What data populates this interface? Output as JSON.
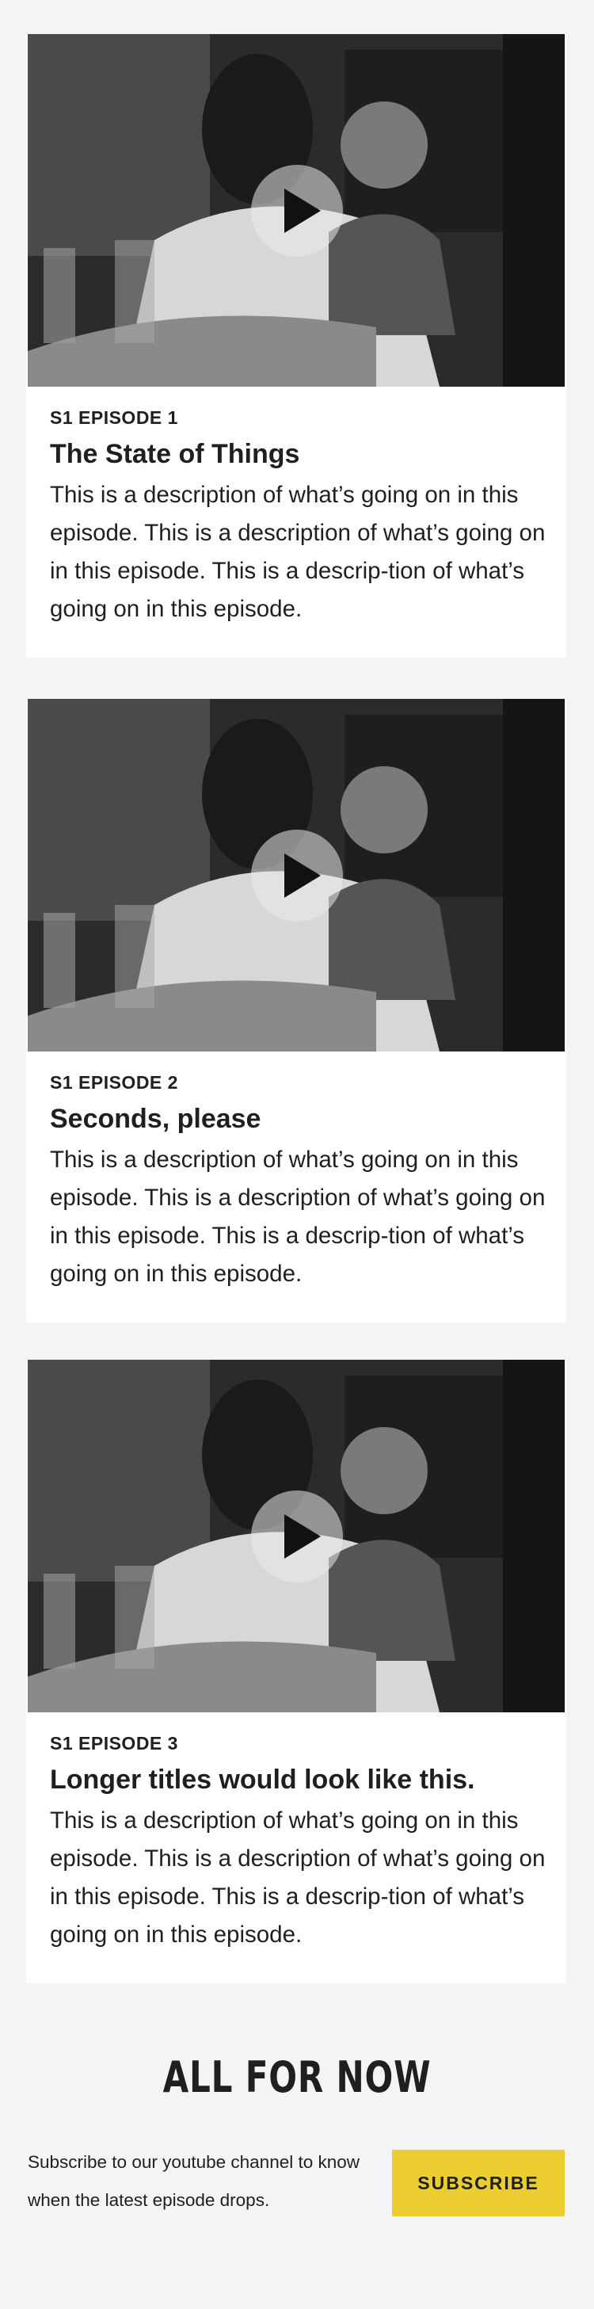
{
  "episodes": [
    {
      "episode_label": "S1 EPISODE 1",
      "title": "The State of Things",
      "description": "This is a description of what’s going on in this episode. This is a description of what’s going on in this episode. This is a descrip-tion of what’s going on in this episode."
    },
    {
      "episode_label": "S1 EPISODE 2",
      "title": "Seconds, please",
      "description": "This is a description of what’s going on in this episode. This is a description of what’s going on in this episode. This is a descrip-tion of what’s going on in this episode."
    },
    {
      "episode_label": "S1 EPISODE 3",
      "title": "Longer titles would look like this.",
      "description": "This is a description of what’s going on in this episode. This is a description of what’s going on in this episode. This is a descrip-tion of what’s going on in this episode."
    }
  ],
  "footer": {
    "heading": "ALL FOR NOW",
    "subscribe_text": "Subscribe to our youtube channel to know when the latest episode drops.",
    "subscribe_button": "SUBSCRIBE"
  },
  "colors": {
    "page_background": "#f4f4f4",
    "card_background": "#ffffff",
    "accent_button": "#ebcd30",
    "text": "#1f1f1f"
  },
  "icons": {
    "play": "play-icon"
  }
}
